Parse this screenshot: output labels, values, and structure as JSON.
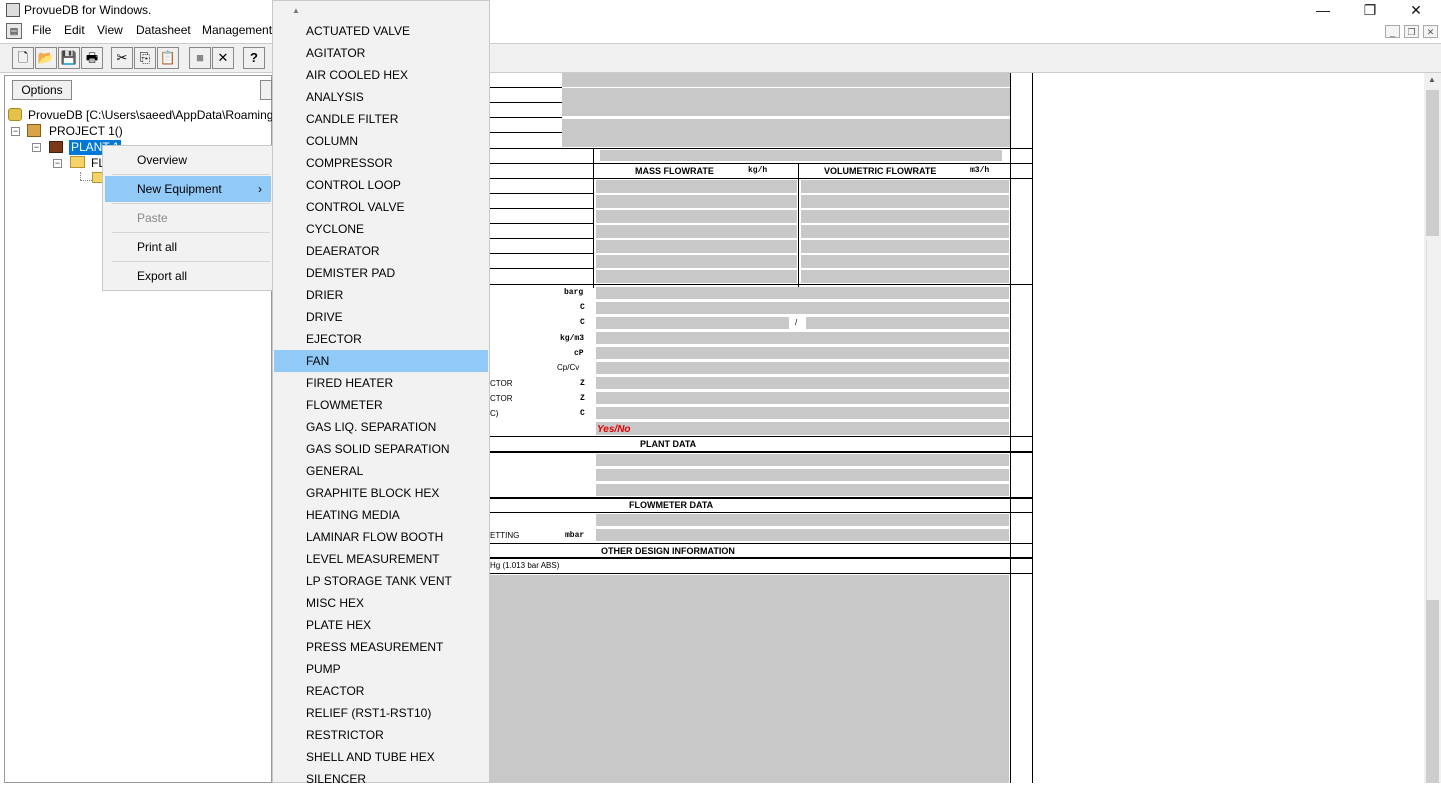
{
  "window": {
    "title": "ProvueDB for Windows.",
    "minimize": "—",
    "maximize": "❐",
    "close": "✕"
  },
  "menubar": {
    "items": [
      "File",
      "Edit",
      "View",
      "Datasheet",
      "Management"
    ]
  },
  "mdi_controls": {
    "minimize": "_",
    "restore": "❐",
    "close": "✕"
  },
  "toolbar": {
    "icons": [
      "new-icon",
      "open-icon",
      "save-icon",
      "print-icon",
      "cut-icon",
      "copy-icon",
      "paste-icon",
      "stop-icon",
      "delete-icon",
      "help-icon"
    ],
    "glyphs": [
      "🗋",
      "📂",
      "💾",
      "🖶",
      "✂",
      "⎘",
      "📋",
      "■",
      "✕",
      "?"
    ]
  },
  "tree": {
    "options_label": "Options",
    "root": "ProvueDB [C:\\Users\\saeed\\AppData\\Roaming\\PE",
    "project": "PROJECT 1()",
    "plant": "PLANT 1",
    "folder": "FL"
  },
  "context_menu": {
    "items": [
      "Overview",
      "New Equipment",
      "Paste",
      "Print all",
      "Export all"
    ],
    "submenu_arrow": "›"
  },
  "equipment_menu": {
    "scroll_up": "▲",
    "selected": "FAN",
    "items": [
      "ACTUATED VALVE",
      "AGITATOR",
      "AIR COOLED HEX",
      "ANALYSIS",
      "CANDLE FILTER",
      "COLUMN",
      "COMPRESSOR",
      "CONTROL LOOP",
      "CONTROL VALVE",
      "CYCLONE",
      "DEAERATOR",
      "DEMISTER PAD",
      "DRIER",
      "DRIVE",
      "EJECTOR",
      "FAN",
      "FIRED HEATER",
      "FLOWMETER",
      "GAS LIQ. SEPARATION",
      "GAS SOLID SEPARATION",
      "GENERAL",
      "GRAPHITE BLOCK HEX",
      "HEATING MEDIA",
      "LAMINAR FLOW BOOTH",
      "LEVEL MEASUREMENT",
      "LP STORAGE TANK VENT",
      "MISC HEX",
      "PLATE HEX",
      "PRESS MEASUREMENT",
      "PUMP",
      "REACTOR",
      "RELIEF (RST1-RST10)",
      "RESTRICTOR",
      "SHELL AND TUBE HEX",
      "SILENCER"
    ]
  },
  "datasheet": {
    "mass_flowrate": "MASS FLOWRATE",
    "mass_unit": "kg/h",
    "vol_flowrate": "VOLUMETRIC FLOWRATE",
    "vol_unit": "m3/h",
    "units": [
      "barg",
      "C",
      "C",
      "kg/m3",
      "cP",
      "Cp/Cv",
      "Z",
      "Z",
      "C"
    ],
    "labels_partial": [
      "CTOR",
      "CTOR",
      "C)"
    ],
    "slash": "/",
    "yes_no": "Yes/No",
    "plant_data": "PLANT DATA",
    "flowmeter_data": "FLOWMETER DATA",
    "setting_label": "ETTING",
    "setting_unit": "mbar",
    "other_design": "OTHER DESIGN INFORMATION",
    "hg_note": "Hg (1.013 bar ABS)"
  },
  "colors": {
    "selection": "#91c9f7",
    "tree_selection": "#0078d7",
    "field_grey": "#c8c8c8",
    "yes_no_red": "#e00000"
  }
}
